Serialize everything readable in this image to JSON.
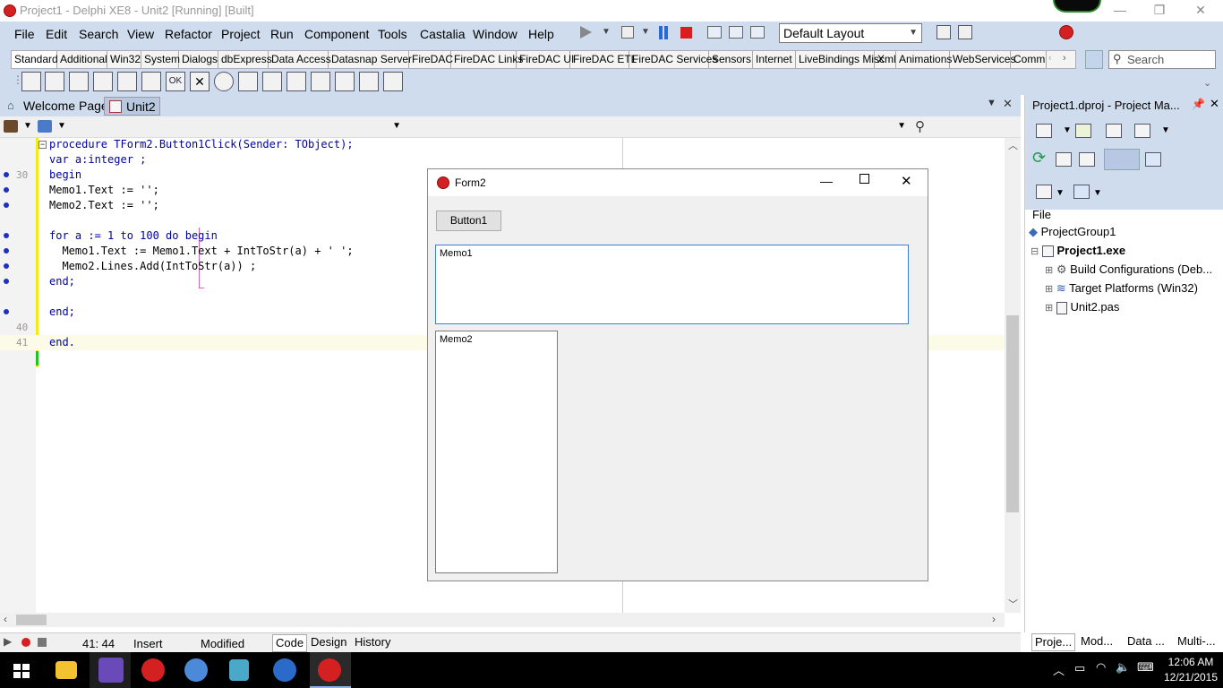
{
  "window": {
    "title": "Project1 - Delphi XE8 - Unit2 [Running] [Built]"
  },
  "menu": [
    "File",
    "Edit",
    "Search",
    "View",
    "Refactor",
    "Project",
    "Run",
    "Component",
    "Tools",
    "Castalia",
    "Window",
    "Help"
  ],
  "layout_combo": "Default Layout",
  "palette_tabs": [
    "Standard",
    "Additional",
    "Win32",
    "System",
    "Dialogs",
    "dbExpress",
    "Data Access",
    "Datasnap Server",
    "FireDAC",
    "FireDAC Links",
    "FireDAC UI",
    "FireDAC ETL",
    "FireDAC Services",
    "Sensors",
    "Internet",
    "LiveBindings Misc",
    "Xml",
    "Animations",
    "WebServices",
    "Comm"
  ],
  "search_placeholder": "Search",
  "editor_tabs": {
    "welcome": "Welcome Page",
    "unit2": "Unit2"
  },
  "code": {
    "line1": "procedure TForm2.Button1Click(Sender: TObject);",
    "line2": "var a:integer ;",
    "line3": "begin",
    "line4": "Memo1.Text := '';",
    "line5": "Memo2.Text := '';",
    "line6": "for a := 1 to 100 do begin",
    "line7": "  Memo1.Text := Memo1.Text + IntToStr(a) + ' ';",
    "line8": "  Memo2.Lines.Add(IntToStr(a)) ;",
    "line9": "end;",
    "line10": "end;",
    "line11": "end.",
    "ln30": "30",
    "ln40": "40",
    "ln41": "41"
  },
  "form2": {
    "title": "Form2",
    "button": "Button1",
    "memo1": "Memo1",
    "memo2": "Memo2"
  },
  "project_manager": {
    "title": "Project1.dproj - Project Ma...",
    "file_label": "File",
    "group": "ProjectGroup1",
    "project": "Project1.exe",
    "build": "Build Configurations (Deb...",
    "target": "Target Platforms (Win32)",
    "unit": "Unit2.pas",
    "tabs": [
      "Proje...",
      "Mod...",
      "Data ...",
      "Multi-..."
    ]
  },
  "status": {
    "position": "41: 44",
    "mode": "Insert",
    "state": "Modified",
    "tabs": [
      "Code",
      "Design",
      "History"
    ]
  },
  "clock": {
    "time": "12:06 AM",
    "date": "12/21/2015"
  },
  "colors": {
    "chrome": "#cfdcee",
    "keyword": "#0000a0",
    "number": "#0a3aff",
    "breakpoint_dot": "#1f2fbf"
  }
}
